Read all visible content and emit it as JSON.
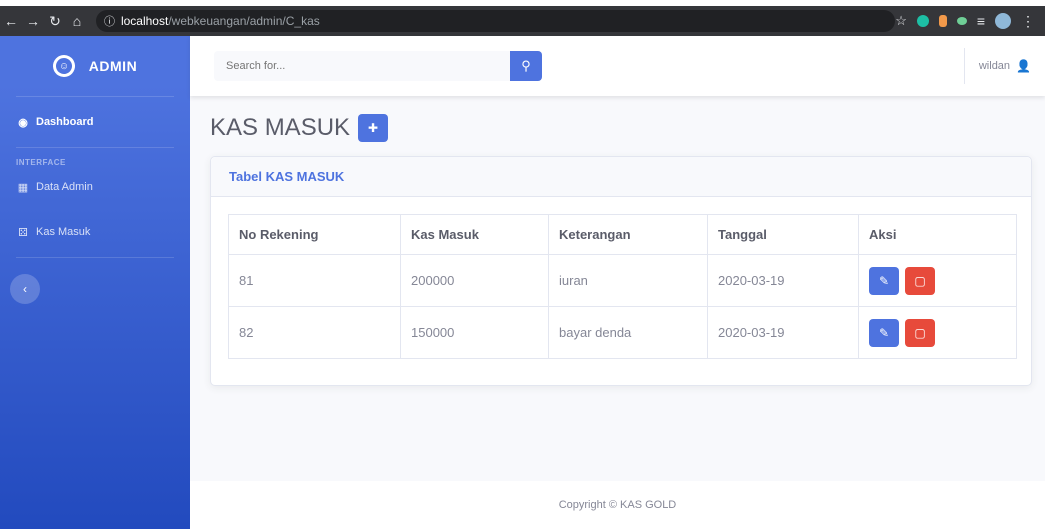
{
  "browser": {
    "url_host": "localhost",
    "url_path": "/webkeuangan/admin/C_kas"
  },
  "sidebar": {
    "brand": "ADMIN",
    "items": [
      {
        "label": "Dashboard"
      },
      {
        "label": "Data Admin"
      },
      {
        "label": "Kas Masuk"
      }
    ],
    "heading": "INTERFACE"
  },
  "topbar": {
    "search_placeholder": "Search for...",
    "user_name": "wildan"
  },
  "main": {
    "title": "KAS MASUK",
    "card_title": "Tabel KAS MASUK",
    "columns": [
      "No Rekening",
      "Kas Masuk",
      "Keterangan",
      "Tanggal",
      "Aksi"
    ],
    "rows": [
      {
        "no_rekening": "81",
        "kas_masuk": "200000",
        "keterangan": "iuran",
        "tanggal": "2020-03-19"
      },
      {
        "no_rekening": "82",
        "kas_masuk": "150000",
        "keterangan": "bayar denda",
        "tanggal": "2020-03-19"
      }
    ]
  },
  "footer": {
    "copyright": "Copyright © KAS GOLD"
  },
  "colors": {
    "primary": "#4e73df",
    "danger": "#e74a3b"
  }
}
